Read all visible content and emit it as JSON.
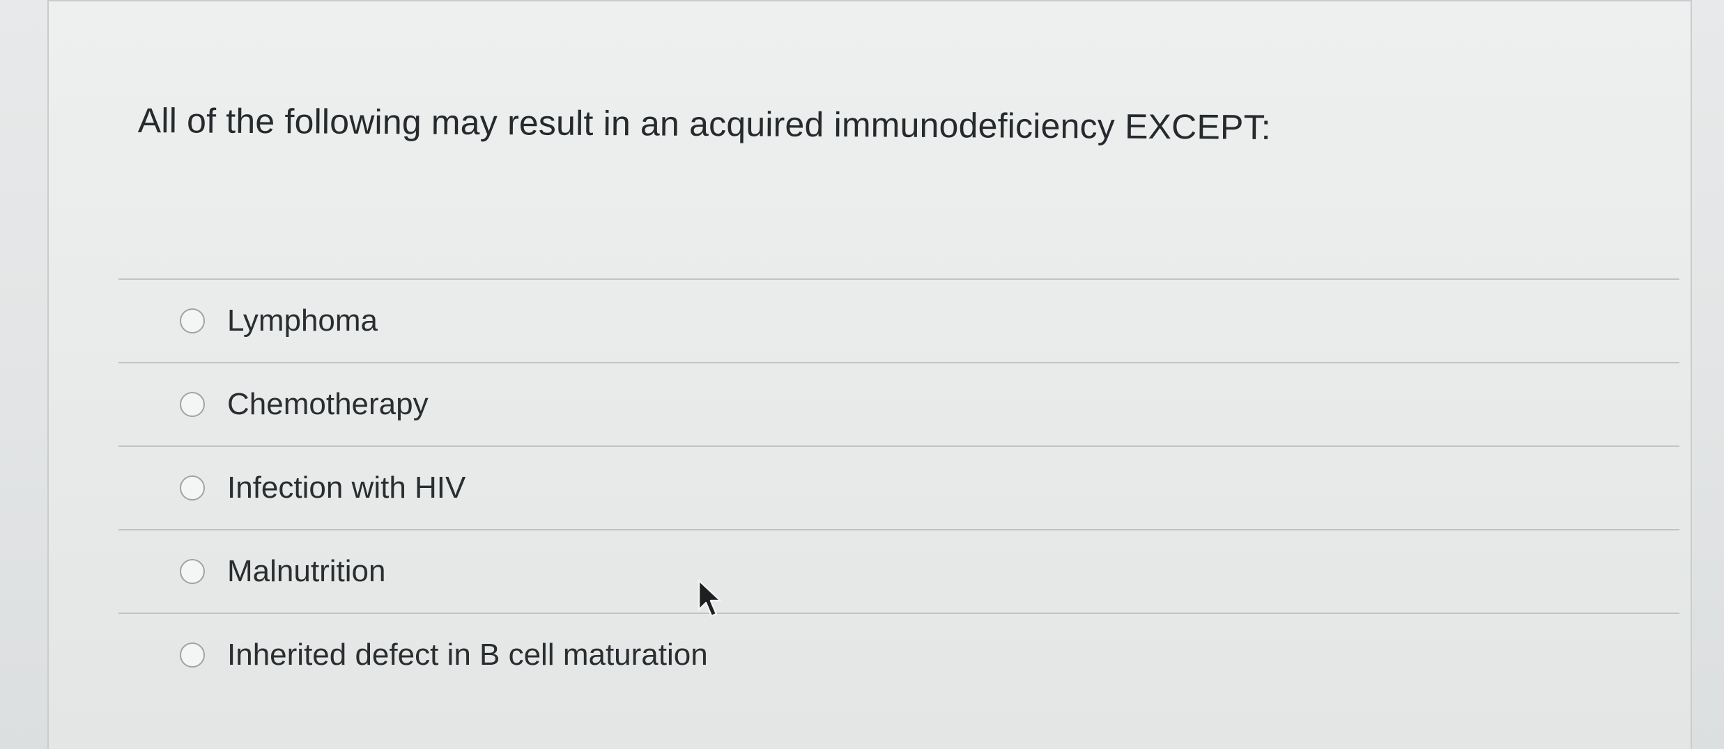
{
  "question": {
    "text": "All of the following may result in an acquired immunodeficiency EXCEPT:"
  },
  "options": [
    {
      "label": "Lymphoma"
    },
    {
      "label": "Chemotherapy"
    },
    {
      "label": "Infection with HIV"
    },
    {
      "label": "Malnutrition"
    },
    {
      "label": "Inherited defect in B cell maturation"
    }
  ],
  "icons": {
    "radio": "radio-button-icon",
    "cursor": "mouse-pointer-icon"
  }
}
